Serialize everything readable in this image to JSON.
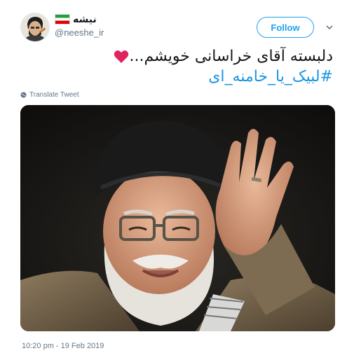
{
  "user": {
    "display_name": "نیشه",
    "handle": "@neeshe_ir"
  },
  "actions": {
    "follow_label": "Follow"
  },
  "tweet": {
    "text_line1": "دلبسته آقای خراسانی خویشم...",
    "hashtag": "#لبیک_یا_خامنه_ای",
    "translate_label": "Translate Tweet",
    "timestamp": "10:20 pm - 19 Feb 2019"
  },
  "icons": {
    "heart": "heart-icon",
    "globe": "globe-icon",
    "chevron": "chevron-down-icon"
  },
  "colors": {
    "accent": "#1da1f2",
    "link": "#1b95e0",
    "heart": "#e0245e",
    "muted": "#657786"
  }
}
